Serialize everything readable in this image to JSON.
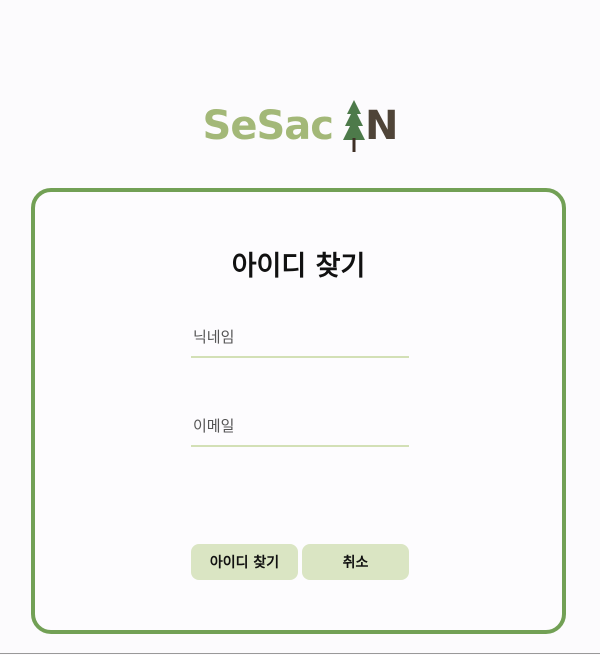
{
  "logo": {
    "part1": "SeSac",
    "part2": "N"
  },
  "form": {
    "title": "아이디 찾기",
    "nickname_placeholder": "닉네임",
    "email_placeholder": "이메일",
    "find_button": "아이디 찾기",
    "cancel_button": "취소"
  },
  "colors": {
    "accent": "#72a055",
    "button_bg": "#dae5c3",
    "logo_green": "#a3b878",
    "logo_brown": "#4f4438"
  }
}
